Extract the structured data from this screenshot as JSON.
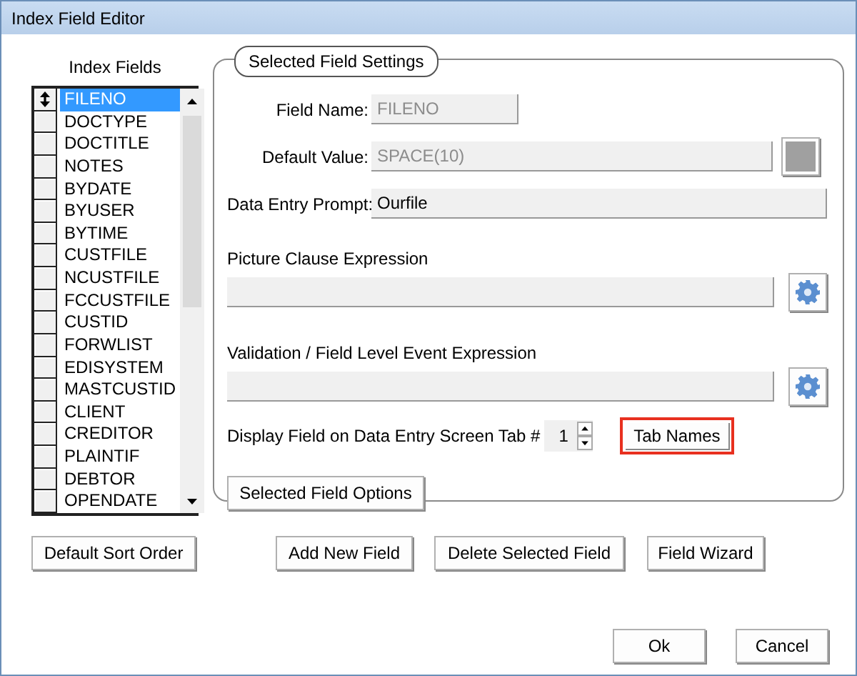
{
  "window": {
    "title": "Index Field Editor"
  },
  "index_fields": {
    "label": "Index Fields",
    "items": [
      {
        "name": "FILENO",
        "selected": true
      },
      {
        "name": "DOCTYPE",
        "selected": false
      },
      {
        "name": "DOCTITLE",
        "selected": false
      },
      {
        "name": "NOTES",
        "selected": false
      },
      {
        "name": "BYDATE",
        "selected": false
      },
      {
        "name": "BYUSER",
        "selected": false
      },
      {
        "name": "BYTIME",
        "selected": false
      },
      {
        "name": "CUSTFILE",
        "selected": false
      },
      {
        "name": "NCUSTFILE",
        "selected": false
      },
      {
        "name": "FCCUSTFILE",
        "selected": false
      },
      {
        "name": "CUSTID",
        "selected": false
      },
      {
        "name": "FORWLIST",
        "selected": false
      },
      {
        "name": "EDISYSTEM",
        "selected": false
      },
      {
        "name": "MASTCUSTID",
        "selected": false
      },
      {
        "name": "CLIENT",
        "selected": false
      },
      {
        "name": "CREDITOR",
        "selected": false
      },
      {
        "name": "PLAINTIF",
        "selected": false
      },
      {
        "name": "DEBTOR",
        "selected": false
      },
      {
        "name": "OPENDATE",
        "selected": false
      }
    ]
  },
  "settings": {
    "title": "Selected Field Settings",
    "field_name": {
      "label": "Field Name:",
      "value": "FILENO",
      "disabled": true
    },
    "default_value": {
      "label": "Default Value:",
      "value": "SPACE(10)",
      "disabled": true
    },
    "data_entry_prompt": {
      "label": "Data Entry Prompt:",
      "value": "Ourfile",
      "disabled": false
    },
    "picture_clause": {
      "label": "Picture Clause Expression"
    },
    "validation": {
      "label": "Validation / Field Level Event Expression"
    },
    "display_tab": {
      "label": "Display Field on Data Entry Screen Tab #",
      "value": "1"
    },
    "tab_names_button": {
      "label": "Tab Names",
      "highlighted": true
    },
    "options_button": "Selected Field Options"
  },
  "default_sort_button": "Default Sort Order",
  "action_buttons": [
    "Add New Field",
    "Delete Selected Field",
    "Field Wizard"
  ],
  "dialog_buttons": [
    "Ok",
    "Cancel"
  ]
}
